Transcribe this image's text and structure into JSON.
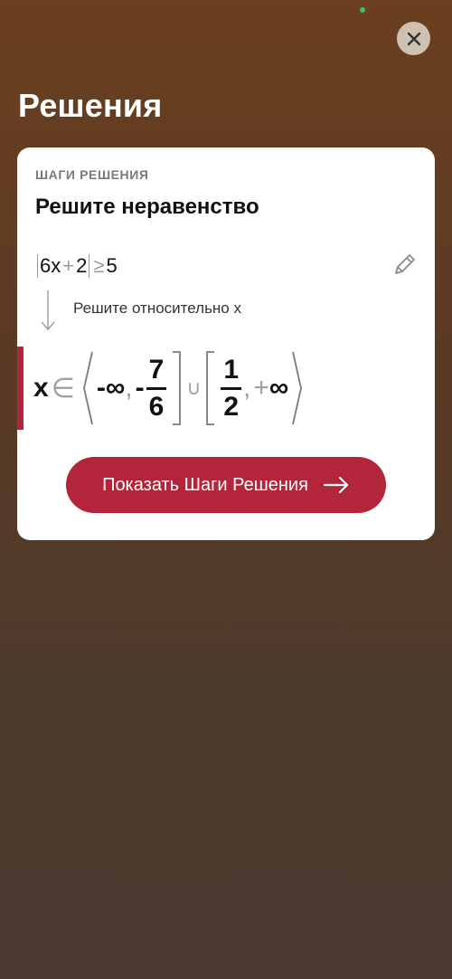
{
  "page": {
    "title": "Решения"
  },
  "card": {
    "label": "ШАГИ РЕШЕНИЯ",
    "heading": "Решите неравенство",
    "equation": {
      "coef": "6",
      "variable": "x",
      "plus": "+",
      "constant": "2",
      "relation": "≥",
      "rhs": "5"
    },
    "step_text": "Решите относительно x",
    "result": {
      "variable": "x",
      "element_of": "∈",
      "neg_inf": "-∞",
      "comma1": ",",
      "minus": "-",
      "frac1_num": "7",
      "frac1_den": "6",
      "union": "∪",
      "frac2_num": "1",
      "frac2_den": "2",
      "comma2": ",",
      "plus": "+",
      "inf": "∞"
    },
    "button_label": "Показать Шаги Решения"
  },
  "icons": {
    "close": "close-icon",
    "edit": "pencil-icon",
    "step": "arrow-down-icon",
    "button": "arrow-right-icon"
  },
  "colors": {
    "accent": "#b2253a",
    "status": "#35c759"
  }
}
